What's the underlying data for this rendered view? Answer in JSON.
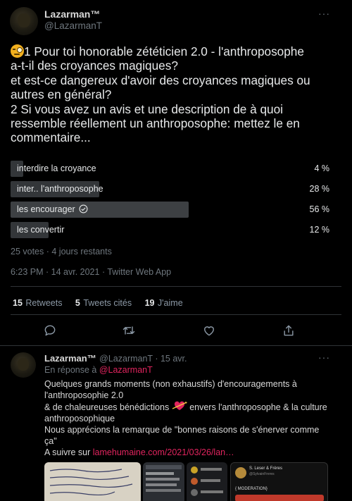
{
  "main_tweet": {
    "author_name": "Lazarman™",
    "author_handle": "@LazarmanT",
    "more_label": "···",
    "text_lines": [
      "1 Pour toi honorable zététicien 2.0 - l'anthroposophe",
      "a-t-il des croyances magiques?",
      "et est-ce dangereux d'avoir des croyances magiques ou",
      "autres en général?",
      "2 Si vous avez un avis et une description de à quoi",
      "ressemble réellement un anthroposophe: mettez le en",
      "commentaire..."
    ],
    "poll": {
      "options": [
        {
          "label": "interdire la croyance",
          "percent_text": "4 %",
          "percent": 4
        },
        {
          "label": "inter.. l'anthroposophe",
          "percent_text": "28 %",
          "percent": 28
        },
        {
          "label": "les encourager",
          "percent_text": "56 %",
          "percent": 56,
          "winner": true
        },
        {
          "label": "les convertir",
          "percent_text": "12 %",
          "percent": 12
        }
      ],
      "summary": "25 votes · 4 jours restants"
    },
    "timestamp": "6:23 PM · 14 avr. 2021 · Twitter Web App",
    "stats": {
      "retweets_count": "15",
      "retweets_label": "Retweets",
      "quotes_count": "5",
      "quotes_label": "Tweets cités",
      "likes_count": "19",
      "likes_label": "J'aime"
    },
    "actions": [
      "reply-icon",
      "retweet-icon",
      "like-icon",
      "share-icon"
    ]
  },
  "reply_tweet": {
    "author_name": "Lazarman™",
    "author_handle_time": "@LazarmanT · 15 avr.",
    "more_label": "···",
    "in_reply_prefix": "En réponse à ",
    "in_reply_handle": "@LazarmanT",
    "lines": [
      "Quelques grands moments (non exhaustifs) d'encouragements à",
      "l'anthroposophie 2.0",
      "& de chaleureuses bénédictions",
      "envers l'anthroposophe & la culture",
      "anthroposophique",
      "Nous apprécions la remarque de \"bonnes raisons de s'énerver comme",
      "ça\"",
      "A suivre sur "
    ],
    "link_text": "lamehumaine.com/2021/03/26/lan…",
    "thumb3_header": "S. Leser & Frères",
    "thumb3_sub": "@SylvainFreres",
    "thumb3_moderation": "{ MODERATION}"
  },
  "colors": {
    "background": "#000000",
    "text": "#e7e9ea",
    "muted": "#6e767d",
    "link": "#e0245e",
    "poll_bar": "#333639"
  }
}
